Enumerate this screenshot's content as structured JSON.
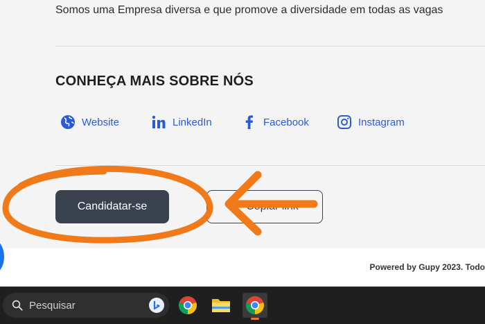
{
  "page": {
    "intro_text": "Somos uma Empresa diversa e que promove a diversidade em todas as vagas",
    "about_heading": "CONHEÇA MAIS SOBRE NÓS",
    "social_links": [
      {
        "label": "Website",
        "icon": "globe-icon"
      },
      {
        "label": "LinkedIn",
        "icon": "linkedin-icon"
      },
      {
        "label": "Facebook",
        "icon": "facebook-icon"
      },
      {
        "label": "Instagram",
        "icon": "instagram-icon"
      }
    ],
    "apply_button": "Candidatar-se",
    "copy_link_button": "Copiar link",
    "footer_text": "Powered by Gupy 2023. Todo"
  },
  "taskbar": {
    "search_placeholder": "Pesquisar",
    "apps": [
      "chrome-icon",
      "file-explorer-icon",
      "chrome-icon"
    ]
  },
  "colors": {
    "accent_link": "#2a5bd7",
    "apply_button_bg": "#3a4250",
    "annotation": "#f07a1a",
    "taskbar_bg": "#1f1f1f"
  }
}
